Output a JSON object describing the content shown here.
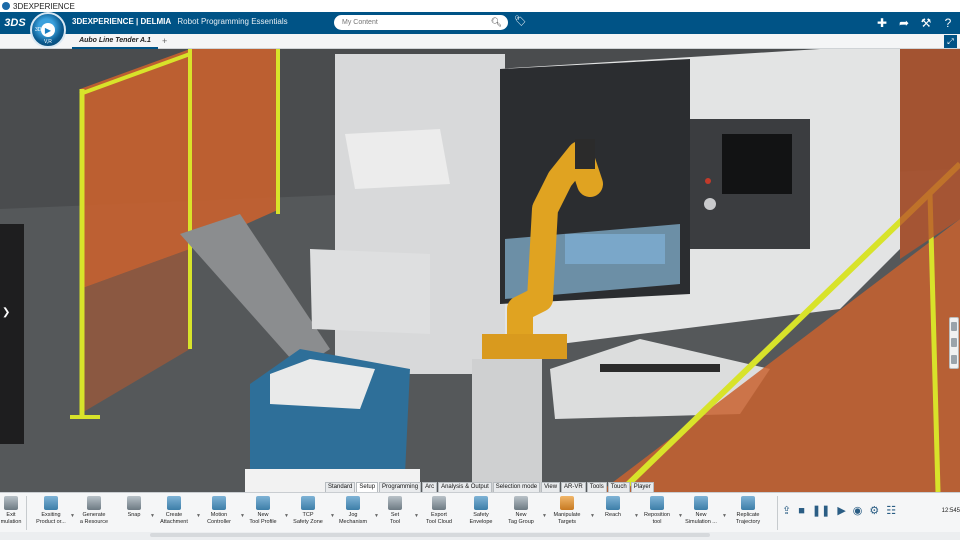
{
  "os_window": {
    "title": "3DEXPERIENCE"
  },
  "topbar": {
    "logo": "3DS",
    "brand_bold": "3DEXPERIENCE | DELMIA",
    "app_name": "Robot Programming Essentials",
    "search_placeholder": "My Content",
    "compass": {
      "north_label": "3D",
      "version_label": "V,R"
    },
    "actions": [
      "plus-icon",
      "share-icon",
      "tools-icon",
      "help-icon"
    ]
  },
  "tabs": {
    "active_tab": "Aubo Line Tender A.1",
    "add_tab": "+"
  },
  "section_tabs": [
    {
      "label": "Standard",
      "active": false
    },
    {
      "label": "Setup",
      "active": true
    },
    {
      "label": "Programming",
      "active": false
    },
    {
      "label": "Arc",
      "active": false
    },
    {
      "label": "Analysis & Output",
      "active": false
    },
    {
      "label": "Selection mode",
      "active": false
    },
    {
      "label": "View",
      "active": false
    },
    {
      "label": "AR-VR",
      "active": false
    },
    {
      "label": "Tools",
      "active": false
    },
    {
      "label": "Touch",
      "active": false
    },
    {
      "label": "Player",
      "active": false
    }
  ],
  "commands": [
    {
      "label": "Exit\nmulation",
      "icon": "exit-icon"
    },
    {
      "label": "Exsiting\nProduct or...",
      "icon": "existing-product-icon"
    },
    {
      "label": "Generate\na Resource",
      "icon": "generate-resource-icon"
    },
    {
      "label": "Snap",
      "icon": "snap-icon"
    },
    {
      "label": "Create\nAttachment",
      "icon": "attachment-icon"
    },
    {
      "label": "Motion\nController",
      "icon": "motion-controller-icon"
    },
    {
      "label": "New\nTool Profile",
      "icon": "tool-profile-icon"
    },
    {
      "label": "TCP\nSafety Zone",
      "icon": "tcp-safety-zone-icon"
    },
    {
      "label": "Jog\nMechanism",
      "icon": "jog-mechanism-icon"
    },
    {
      "label": "Set\nTool",
      "icon": "set-tool-icon"
    },
    {
      "label": "Export\nTool Cloud",
      "icon": "export-tool-cloud-icon"
    },
    {
      "label": "Safety\nEnvelope",
      "icon": "safety-envelope-icon"
    },
    {
      "label": "New\nTag Group",
      "icon": "tag-group-icon"
    },
    {
      "label": "Manipulate\nTargets",
      "icon": "manipulate-targets-icon"
    },
    {
      "label": "Reach",
      "icon": "reach-icon"
    },
    {
      "label": "Reposition\ntool",
      "icon": "reposition-tool-icon"
    },
    {
      "label": "New\nSimulation ...",
      "icon": "new-simulation-icon"
    },
    {
      "label": "Replicate\nTrajectory",
      "icon": "replicate-trajectory-icon"
    }
  ],
  "player_controls": [
    "export-icon",
    "stop-icon",
    "pause-icon",
    "play-icon",
    "compass-icon",
    "settings-icon",
    "grid-icon"
  ],
  "clock": "12:545"
}
